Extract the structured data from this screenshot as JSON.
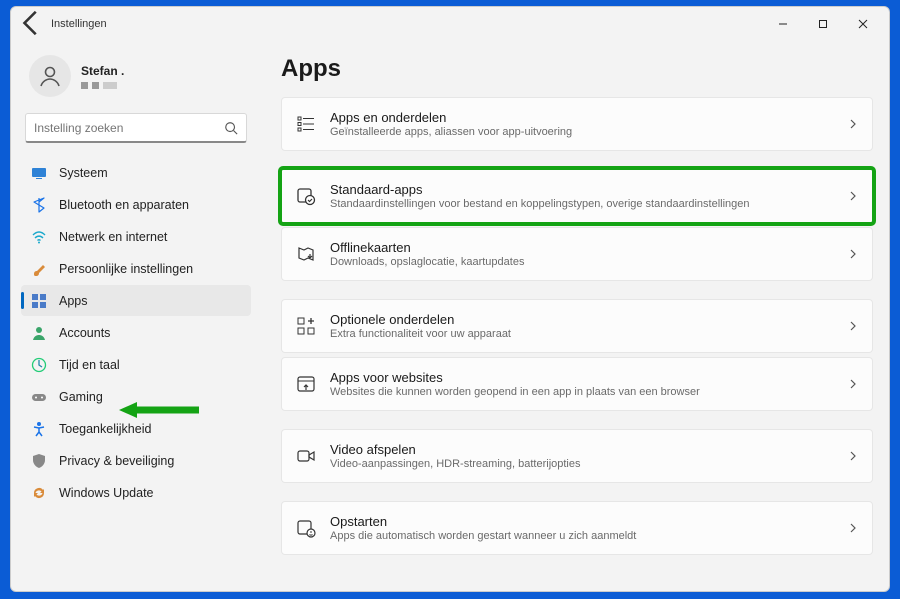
{
  "window": {
    "title": "Instellingen"
  },
  "profile": {
    "name": "Stefan ."
  },
  "search": {
    "placeholder": "Instelling zoeken"
  },
  "sidebar": {
    "items": [
      {
        "label": "Systeem"
      },
      {
        "label": "Bluetooth en apparaten"
      },
      {
        "label": "Netwerk en internet"
      },
      {
        "label": "Persoonlijke instellingen"
      },
      {
        "label": "Apps"
      },
      {
        "label": "Accounts"
      },
      {
        "label": "Tijd en taal"
      },
      {
        "label": "Gaming"
      },
      {
        "label": "Toegankelijkheid"
      },
      {
        "label": "Privacy & beveiliging"
      },
      {
        "label": "Windows Update"
      }
    ]
  },
  "page": {
    "title": "Apps",
    "cards": [
      {
        "title": "Apps en onderdelen",
        "desc": "Geïnstalleerde apps, aliassen voor app-uitvoering"
      },
      {
        "title": "Standaard-apps",
        "desc": "Standaardinstellingen voor bestand en koppelingstypen, overige standaardinstellingen"
      },
      {
        "title": "Offlinekaarten",
        "desc": "Downloads, opslaglocatie, kaartupdates"
      },
      {
        "title": "Optionele onderdelen",
        "desc": "Extra functionaliteit voor uw apparaat"
      },
      {
        "title": "Apps voor websites",
        "desc": "Websites die kunnen worden geopend in een app in plaats van een browser"
      },
      {
        "title": "Video afspelen",
        "desc": "Video-aanpassingen, HDR-streaming, batterijopties"
      },
      {
        "title": "Opstarten",
        "desc": "Apps die automatisch worden gestart wanneer u zich aanmeldt"
      }
    ]
  }
}
